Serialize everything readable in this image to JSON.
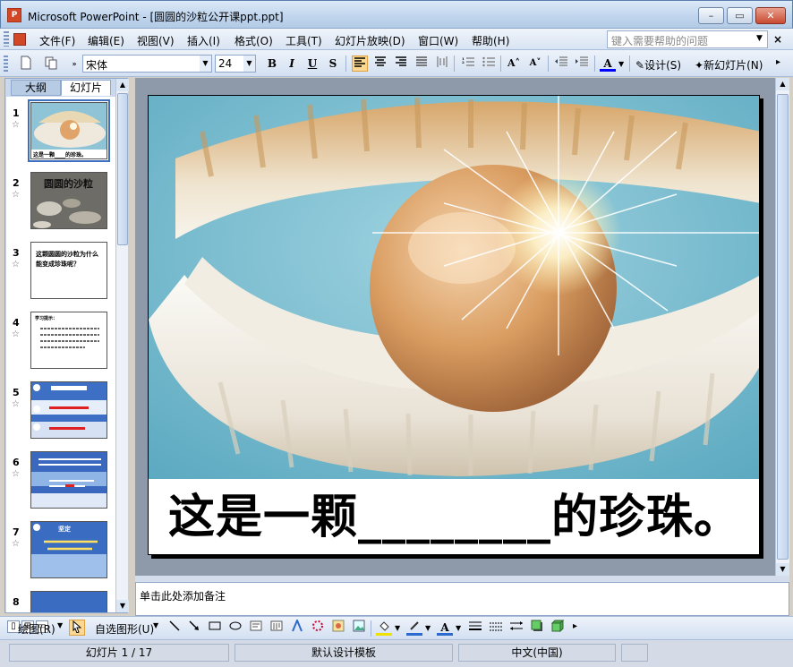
{
  "window": {
    "title": "Microsoft PowerPoint - [圆圆的沙粒公开课ppt.ppt]",
    "app_icon_label": "P",
    "minimize": "–",
    "restore": "▭",
    "close": "✕"
  },
  "menu": {
    "items": [
      "文件(F)",
      "编辑(E)",
      "视图(V)",
      "插入(I)",
      "格式(O)",
      "工具(T)",
      "幻灯片放映(D)",
      "窗口(W)",
      "帮助(H)"
    ],
    "help_placeholder": "键入需要帮助的问题",
    "doc_close": "×"
  },
  "toolbar": {
    "font_name": "宋体",
    "font_size": "24",
    "bold": "B",
    "italic": "I",
    "underline": "U",
    "shadow": "S",
    "increase_font": "A˄",
    "decrease_font": "A˅",
    "font_color": "A",
    "design_label": "设计(S)",
    "new_slide_label": "新幻灯片(N)"
  },
  "left_panel": {
    "tab_outline": "大纲",
    "tab_slides": "幻灯片",
    "close": "×",
    "slides": [
      {
        "num": "1",
        "caption": "这是一颗____的珍珠。"
      },
      {
        "num": "2",
        "caption": "圆圆的沙粒"
      },
      {
        "num": "3",
        "caption": "这颗圆圆的沙粒为什么能变成珍珠呢？"
      },
      {
        "num": "4",
        "caption": "学习提示："
      },
      {
        "num": "5",
        "caption": ""
      },
      {
        "num": "6",
        "caption": ""
      },
      {
        "num": "7",
        "caption": "坚定"
      },
      {
        "num": "8",
        "caption": ""
      }
    ]
  },
  "slide": {
    "caption": "这是一颗________的珍珠。"
  },
  "notes": {
    "placeholder": "单击此处添加备注"
  },
  "drawing_toolbar": {
    "draw_label": "绘图(R)",
    "autoshapes_label": "自选图形(U)"
  },
  "status": {
    "slide_position": "幻灯片 1 / 17",
    "template": "默认设计模板",
    "language": "中文(中国)"
  },
  "colors": {
    "accent": "#3c6fc0",
    "title_bar": "#c1d6ee",
    "stage_background": "#8e99aa"
  }
}
